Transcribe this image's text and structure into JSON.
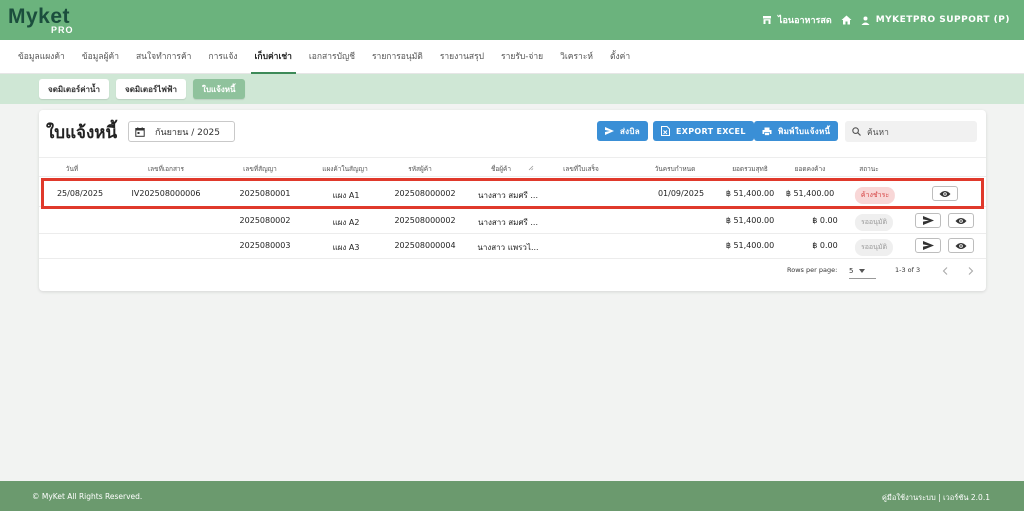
{
  "app": {
    "logo_main": "Myket",
    "logo_sub": "PRO"
  },
  "topbar": {
    "store_name": "ไอนอาหารสด",
    "user_name": "MYKETPRO SUPPORT (P)",
    "store_icon": "store-icon",
    "home_icon": "home-icon",
    "user_icon": "user-icon"
  },
  "nav": {
    "items": [
      "ข้อมูลแผงค้า",
      "ข้อมูลผู้ค้า",
      "สนใจทำการค้า",
      "การแจ้ง",
      "เก็บค่าเช่า",
      "เอกสารบัญชี",
      "รายการอนุมัติ",
      "รายงานสรุป",
      "รายรับ-จ่าย",
      "วิเคราะห์",
      "ตั้งค่า"
    ],
    "active": "เก็บค่าเช่า"
  },
  "subnav": {
    "items": [
      "จดมิเตอร์ค่าน้ำ",
      "จดมิเตอร์ไฟฟ้า",
      "ใบแจ้งหนี้"
    ],
    "active": "ใบแจ้งหนี้"
  },
  "page": {
    "title": "ใบแจ้งหนี้",
    "month": "กันยายน / 2025"
  },
  "actions": {
    "send": "ส่งบิล",
    "export": "EXPORT EXCEL",
    "print": "พิมพ์ใบแจ้งหนี้",
    "search_placeholder": "ค้นหา"
  },
  "table": {
    "headers": [
      "วันที่",
      "เลขที่เอกสาร",
      "เลขที่สัญญา",
      "แผงค้าในสัญญา",
      "รหัสผู้ค้า",
      "ชื่อผู้ค้า",
      "เลขที่ใบเสร็จ",
      "วันครบกำหนด",
      "ยอดรวมสุทธิ",
      "ยอดคงค้าง",
      "สถานะ"
    ],
    "rows": [
      {
        "date": "25/08/2025",
        "doc_no": "IV202508000006",
        "contract": "2025080001",
        "stall": "แผง A1",
        "vendor_code": "202508000002",
        "vendor_name": "นางสาว สมศรี ...",
        "receipt": "",
        "due": "01/09/2025",
        "total": "฿ 51,400.00",
        "balance": "฿ 51,400.00",
        "status": "ค้างชำระ",
        "status_color": "#d64545"
      },
      {
        "date": "",
        "doc_no": "",
        "contract": "2025080002",
        "stall": "แผง A2",
        "vendor_code": "202508000002",
        "vendor_name": "นางสาว สมศรี ...",
        "receipt": "",
        "due": "",
        "total": "฿ 51,400.00",
        "balance": "฿ 0.00",
        "status": "รออนุมัติ",
        "status_color": "#9a9a9a"
      },
      {
        "date": "",
        "doc_no": "",
        "contract": "2025080003",
        "stall": "แผง A3",
        "vendor_code": "202508000004",
        "vendor_name": "นางสาว แพรวไ...",
        "receipt": "",
        "due": "",
        "total": "฿ 51,400.00",
        "balance": "฿ 0.00",
        "status": "รออนุมัติ",
        "status_color": "#9a9a9a"
      }
    ]
  },
  "pagination": {
    "rows_per_page_label": "Rows per page:",
    "rows_per_page": "5",
    "range": "1-3 of 3"
  },
  "footer": {
    "copyright": "© MyKet All Rights Reserved.",
    "right": "คู่มือใช้งานระบบ | เวอร์ชัน 2.0.1"
  },
  "colors": {
    "primary_green": "#6bb37d",
    "accent_blue": "#3a8fd6",
    "highlight_red": "#e0392b"
  }
}
